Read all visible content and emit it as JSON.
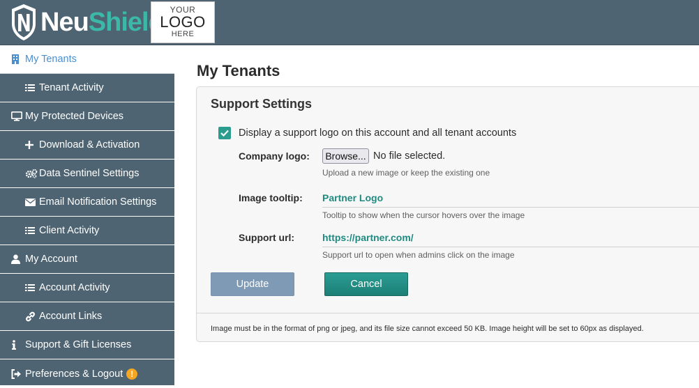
{
  "header": {
    "brand_neu": "Neu",
    "brand_shield": "Shield",
    "custom_logo": {
      "line1": "YOUR",
      "line2": "LOGO",
      "line3": "HERE"
    }
  },
  "sidebar": {
    "items": [
      {
        "label": "My Tenants",
        "icon": "building-icon",
        "active": true
      },
      {
        "label": "Tenant Activity",
        "icon": "list-icon"
      },
      {
        "label": "My Protected Devices",
        "icon": "monitor-icon"
      },
      {
        "label": "Download & Activation",
        "icon": "plus-icon"
      },
      {
        "label": "Data Sentinel Settings",
        "icon": "gears-icon"
      },
      {
        "label": "Email Notification Settings",
        "icon": "envelope-icon"
      },
      {
        "label": "Client Activity",
        "icon": "list-icon"
      },
      {
        "label": "My Account",
        "icon": "user-icon"
      },
      {
        "label": "Account Activity",
        "icon": "list-icon"
      },
      {
        "label": "Account Links",
        "icon": "link-icon"
      },
      {
        "label": "Support & Gift Licenses",
        "icon": "info-icon"
      },
      {
        "label": "Preferences & Logout",
        "icon": "sign-out-icon",
        "badge": "!"
      }
    ]
  },
  "main": {
    "page_title": "My Tenants",
    "panel": {
      "title": "Support Settings",
      "checkbox_label": "Display a support logo on this account and all tenant accounts",
      "checkbox_checked": true,
      "company_logo": {
        "label": "Company logo:",
        "browse_label": "Browse...",
        "file_status": "No file selected.",
        "hint": "Upload a new image or keep the existing one"
      },
      "image_tooltip": {
        "label": "Image tooltip:",
        "value": "Partner Logo",
        "hint": "Tooltip to show when the cursor hovers over the image"
      },
      "support_url": {
        "label": "Support url:",
        "value": "https://partner.com/",
        "hint": "Support url to open when admins click on the image"
      },
      "update_label": "Update",
      "cancel_label": "Cancel",
      "footer_note": "Image must be in the format of png or jpeg, and its file size cannot exceed 50 KB. Image height will be set to 60px as displayed."
    }
  },
  "colors": {
    "header_bg": "#4e6472",
    "accent_teal": "#2a9d8f",
    "active_link": "#4a8fcf",
    "badge": "#f5a623",
    "update_btn": "#7f9ab5"
  }
}
